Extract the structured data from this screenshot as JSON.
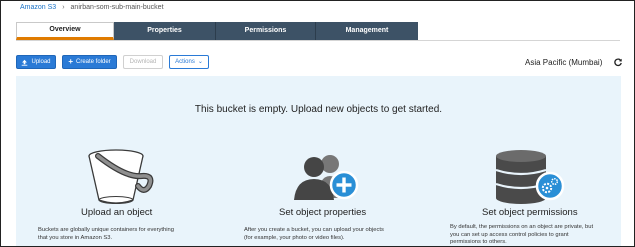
{
  "breadcrumb": {
    "root": "Amazon S3",
    "separator": "›",
    "bucket": "anirban-som-sub-main-bucket"
  },
  "tabs": [
    {
      "label": "Overview",
      "active": true
    },
    {
      "label": "Properties",
      "active": false
    },
    {
      "label": "Permissions",
      "active": false
    },
    {
      "label": "Management",
      "active": false
    }
  ],
  "toolbar": {
    "upload_label": "Upload",
    "create_folder_label": "Create folder",
    "download_label": "Download",
    "actions_label": "Actions"
  },
  "region": "Asia Pacific (Mumbai)",
  "empty_message": "This bucket is empty. Upload new objects to get started.",
  "cards": [
    {
      "title": "Upload an object",
      "desc_lines": [
        "Buckets are globally unique containers for everything",
        "that you store in Amazon S3."
      ],
      "icon": "bucket-icon"
    },
    {
      "title": "Set object properties",
      "desc_lines": [
        "After you create a bucket, you can upload your objects",
        "(for example, your photo or video files)."
      ],
      "icon": "user-plus-icon"
    },
    {
      "title": "Set object permissions",
      "desc_lines": [
        "By default, the permissions on an object are private, but",
        "you can set up access control policies to grant",
        "permissions to others."
      ],
      "icon": "database-gear-icon"
    }
  ],
  "colors": {
    "tab_bg": "#3d5266",
    "tab_active_accent": "#e07b00",
    "primary": "#2a7ad6",
    "panel_bg": "#e9f4fb",
    "icon_dark": "#444444",
    "icon_blue": "#2a8fd6"
  }
}
